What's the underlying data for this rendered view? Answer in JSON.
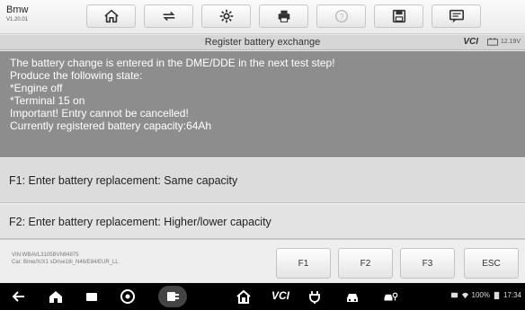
{
  "app": {
    "name": "Bmw",
    "version": "V1.20.01"
  },
  "toolbar": {
    "buttons": [
      {
        "icon": "home-icon"
      },
      {
        "icon": "vehicle-swap-icon"
      },
      {
        "icon": "gear-icon"
      },
      {
        "icon": "print-icon"
      },
      {
        "icon": "help-icon",
        "disabled": true
      },
      {
        "icon": "save-icon"
      },
      {
        "icon": "message-icon"
      }
    ]
  },
  "title_bar": {
    "title": "Register battery exchange",
    "vci_label": "VCI",
    "battery_voltage": "12.19V"
  },
  "message": {
    "lines": [
      "The battery change is entered in the DME/DDE in the next test step!",
      "Produce the following state:",
      "*Engine off",
      "*Terminal 15 on",
      "Important! Entry cannot be cancelled!",
      "Currently registered battery capacity:64Ah"
    ]
  },
  "options": [
    {
      "label": "F1: Enter battery replacement: Same capacity"
    },
    {
      "label": "F2: Enter battery replacement: Higher/lower capacity"
    }
  ],
  "vehicle_info": {
    "vin": "VIN:WBAVL3105BVN94875",
    "car": "Car: Bmw/X/X1 sDrive18i_N46/E84/EUR_LL"
  },
  "function_keys": [
    "F1",
    "F2",
    "F3",
    "ESC"
  ],
  "nav_bar": {
    "vcl_label": "VCI",
    "battery_percent": "100%",
    "time": "17:34"
  },
  "colors": {
    "message_bg": "#8d8d8d",
    "option_bg": "#dcdcdc",
    "toolbar_bg": "#f4f4f4",
    "nav_bg": "#000000"
  }
}
